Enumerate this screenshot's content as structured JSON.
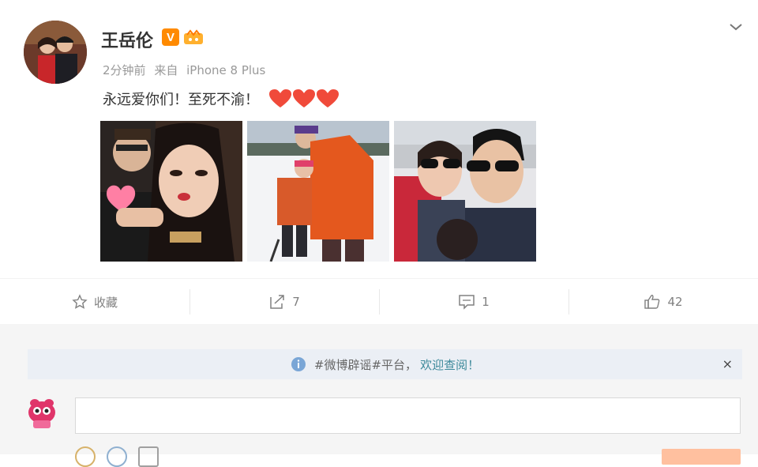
{
  "post": {
    "username": "王岳伦",
    "verified_badge": "V",
    "meta": {
      "time": "2分钟前",
      "source_prefix": "来自",
      "device": "iPhone 8 Plus"
    },
    "content": "永远爱你们！至死不渝！",
    "hearts": 3,
    "photos": [
      "photo-1",
      "photo-2",
      "photo-3"
    ],
    "icons": {
      "collapse": "chevron-down-icon",
      "favorite": "star-icon",
      "repost": "repost-icon",
      "comment": "comment-icon",
      "like": "thumb-up-icon"
    }
  },
  "actions": {
    "favorite_label": "收藏",
    "repost_count": "7",
    "comment_count": "1",
    "like_count": "42"
  },
  "comment_area": {
    "notice_text": "#微博辟谣#平台，",
    "notice_link": "欢迎查阅！",
    "notice_close": "×",
    "input_value": ""
  },
  "colors": {
    "accent": "#ff8200",
    "heart": "#f04a3a",
    "notice_bg": "#ebeff5",
    "link": "#3e8a9b"
  }
}
